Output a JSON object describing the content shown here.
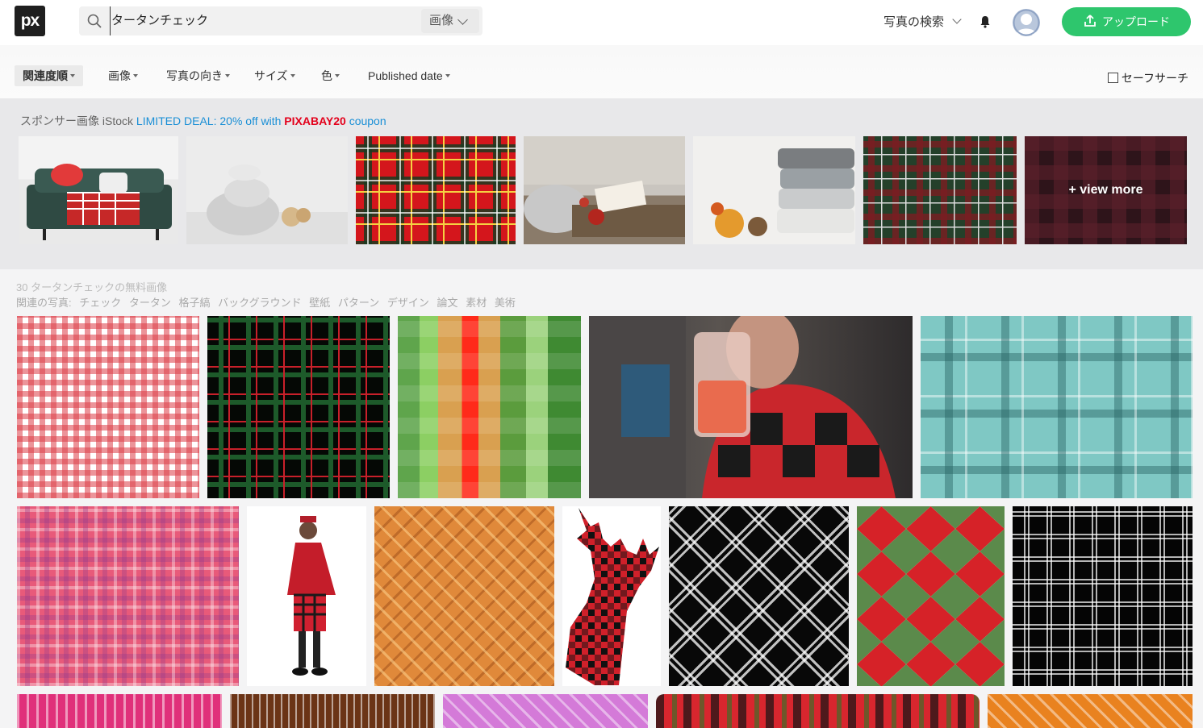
{
  "header": {
    "logo_text": "px",
    "search_value": "タータンチェック",
    "search_type": "画像",
    "explore_label": "写真の検索",
    "upload_label": "アップロード"
  },
  "filters": {
    "items": [
      "関連度順",
      "画像",
      "写真の向き",
      "サイズ",
      "色",
      "Published date"
    ],
    "safe_search": "セーフサーチ"
  },
  "sponsor": {
    "label": "スポンサー画像 iStock",
    "deal": "LIMITED DEAL: 20% off with",
    "code": "PIXABAY20",
    "coupon": "coupon",
    "view_more": "+ view more"
  },
  "results": {
    "count_text": "30 タータンチェックの無料画像",
    "related_label": "関連の写真:",
    "related_tags": [
      "チェック",
      "タータン",
      "格子縞",
      "バックグラウンド",
      "壁紙",
      "パターン",
      "デザイン",
      "論文",
      "素材",
      "美術"
    ]
  },
  "colors": {
    "accent": "#2ec66d",
    "link": "#1a8fd6",
    "coupon_red": "#e3001b"
  }
}
